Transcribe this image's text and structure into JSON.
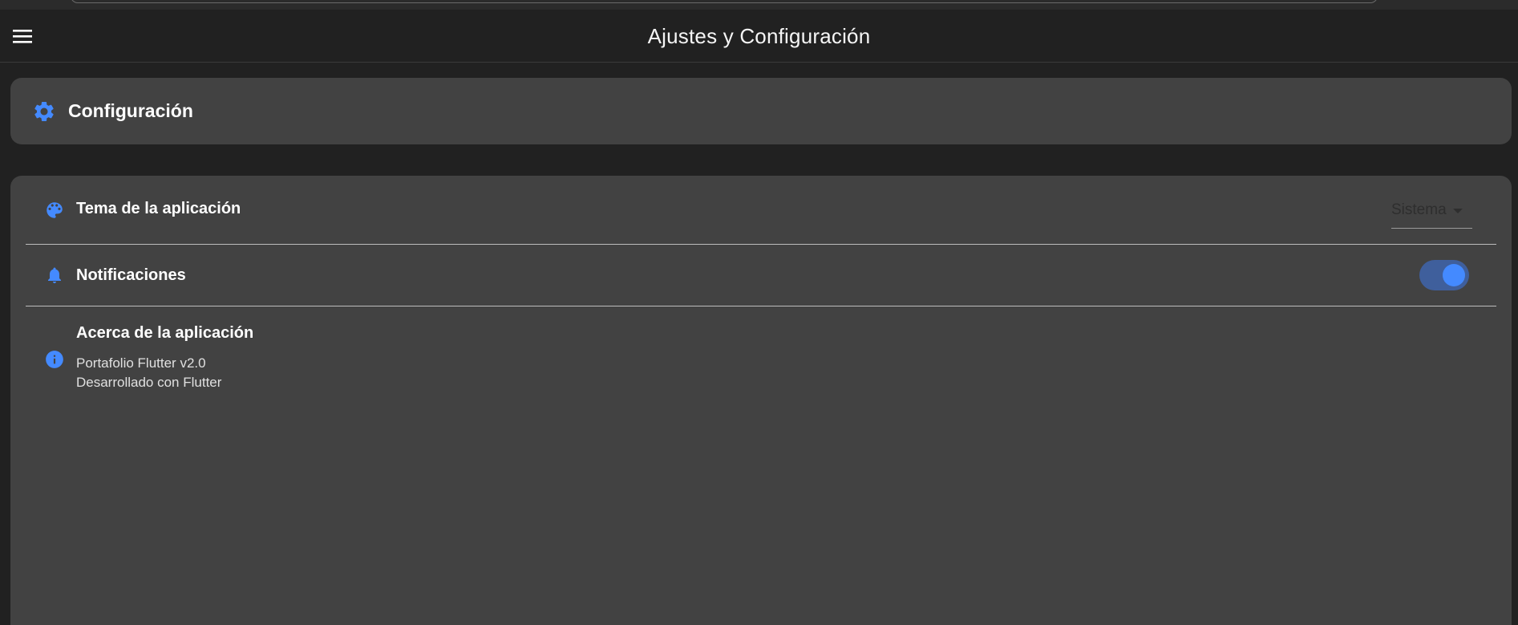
{
  "app_bar": {
    "title": "Ajustes y Configuración",
    "menu_icon": "menu-icon"
  },
  "section_header": {
    "title": "Configuración",
    "icon": "gear-icon"
  },
  "settings": {
    "theme": {
      "label": "Tema de la aplicación",
      "icon": "palette-icon",
      "selected_value": "Sistema"
    },
    "notifications": {
      "label": "Notificaciones",
      "icon": "bell-icon",
      "enabled": true
    },
    "about": {
      "label": "Acerca de la aplicación",
      "icon": "info-icon",
      "line1": "Portafolio Flutter v2.0",
      "line2": "Desarrollado con Flutter"
    }
  },
  "colors": {
    "accent": "#448aff",
    "background": "#212121",
    "card": "#424242",
    "switch_track": "#3f5f9c"
  }
}
